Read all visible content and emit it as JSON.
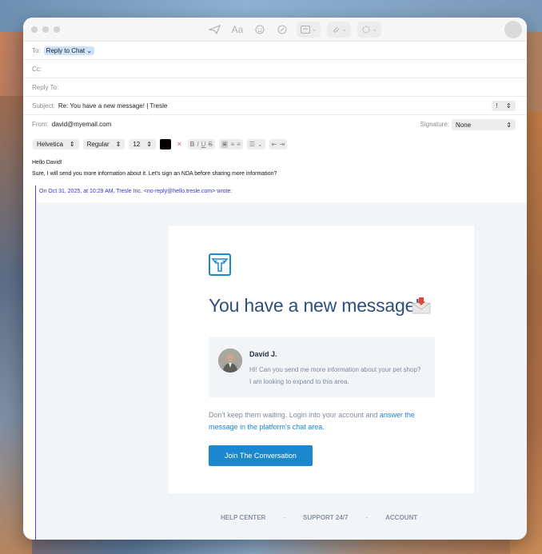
{
  "header": {
    "to_label": "To:",
    "to_token": "Reply to Chat",
    "cc_label": "Cc:",
    "reply_to_label": "Reply To:",
    "subject_label": "Subject:",
    "subject_value": "Re: You have a new message! | Tresle",
    "priority_value": "!",
    "from_label": "From:",
    "from_value": "david@myemail.com",
    "signature_label": "Signature:",
    "signature_value": "None"
  },
  "format": {
    "font": "Helvetica",
    "style": "Regular",
    "size": "12",
    "bold": "B",
    "italic": "I",
    "underline": "U",
    "strike": "S"
  },
  "body": {
    "greeting": "Hello David!",
    "line1": "Sure, I will send you more information about it. Let's sign an NDA before sharing more information?",
    "wrote": "On Oct 31, 2025, at 10:29 AM, Tresle Inc. <no-reply@hello.tresle.com> wrote:"
  },
  "email": {
    "headline": "You have a new message!",
    "sender_name": "David J.",
    "sender_message": "Hi! Can you send me more information about your pet shop? I am looking to expand to this area.",
    "cta_prefix": "Don't keep them waiting. Login into your account and ",
    "cta_link": "answer the message in the platform's chat area.",
    "button": "Join The Conversation",
    "footer": [
      "HELP CENTER",
      "SUPPORT 24/7",
      "ACCOUNT"
    ],
    "footer_separator": "·"
  },
  "colors": {
    "accent": "#1a87cf",
    "headline": "#2c4f7c",
    "quote_bar": "#4b3fd6"
  }
}
